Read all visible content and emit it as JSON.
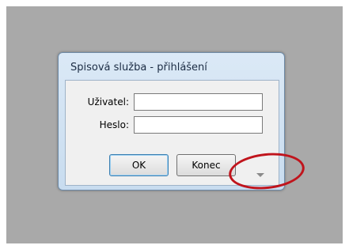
{
  "dialog": {
    "title": "Spisová služba - přihlášení",
    "user_label": "Uživatel:",
    "user_value": "",
    "password_label": "Heslo:",
    "password_value": "",
    "ok_label": "OK",
    "cancel_label": "Konec",
    "expand_icon": "chevron-down-icon"
  },
  "annotation": {
    "color": "#c0141c",
    "shape": "ellipse"
  }
}
